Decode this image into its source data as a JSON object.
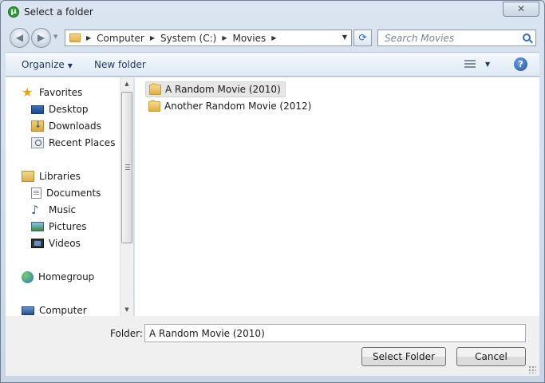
{
  "window": {
    "title": "Select a folder",
    "close_glyph": "✕",
    "app_icon_letter": "μ"
  },
  "address": {
    "crumbs": [
      "Computer",
      "System (C:)",
      "Movies"
    ],
    "search_placeholder": "Search Movies"
  },
  "toolbar": {
    "organize_label": "Organize",
    "new_folder_label": "New folder",
    "help_glyph": "?"
  },
  "nav": {
    "items": [
      {
        "label": "Favorites",
        "icon": "star-icon"
      },
      {
        "label": "Desktop",
        "icon": "desktop-icon"
      },
      {
        "label": "Downloads",
        "icon": "downloads-icon"
      },
      {
        "label": "Recent Places",
        "icon": "recent-places-icon"
      },
      {
        "label": "Libraries",
        "icon": "libraries-icon"
      },
      {
        "label": "Documents",
        "icon": "documents-icon"
      },
      {
        "label": "Music",
        "icon": "music-icon"
      },
      {
        "label": "Pictures",
        "icon": "pictures-icon"
      },
      {
        "label": "Videos",
        "icon": "videos-icon"
      },
      {
        "label": "Homegroup",
        "icon": "homegroup-icon"
      },
      {
        "label": "Computer",
        "icon": "computer-icon"
      }
    ]
  },
  "content": {
    "folders": [
      {
        "name": "A Random Movie (2010)",
        "selected": true
      },
      {
        "name": "Another Random Movie (2012)",
        "selected": false
      }
    ]
  },
  "footer": {
    "folder_label": "Folder:",
    "folder_value": "A Random Movie (2010)",
    "select_button": "Select Folder",
    "cancel_button": "Cancel"
  }
}
